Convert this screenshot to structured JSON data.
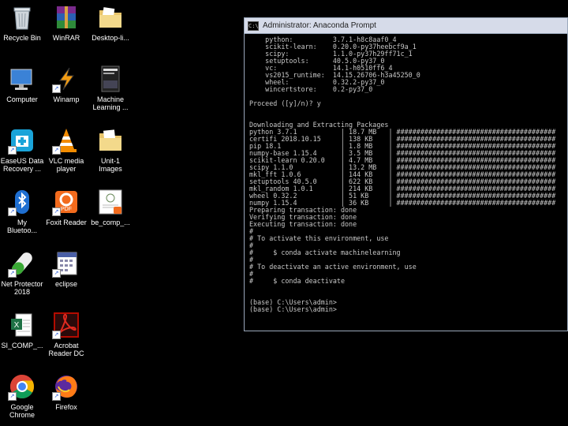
{
  "desktop": {
    "icons": [
      {
        "label": "Recycle Bin"
      },
      {
        "label": "WinRAR"
      },
      {
        "label": "Desktop-li..."
      },
      {
        "label": "Computer"
      },
      {
        "label": "Winamp"
      },
      {
        "label": "Machine\nLearning ..."
      },
      {
        "label": "EaseUS Data\nRecovery ..."
      },
      {
        "label": "VLC media\nplayer"
      },
      {
        "label": "Unit-1\nImages"
      },
      {
        "label": "My\nBluetoo..."
      },
      {
        "label": "Foxit Reader"
      },
      {
        "label": "be_comp_..."
      },
      {
        "label": "Net Protector\n2018"
      },
      {
        "label": "eclipse"
      },
      {
        "label": "SI_COMP_..."
      },
      {
        "label": "Acrobat\nReader DC"
      },
      {
        "label": "Google\nChrome"
      },
      {
        "label": "Firefox"
      }
    ]
  },
  "terminal": {
    "title": "Administrator: Anaconda Prompt",
    "lines": [
      "    python:          3.7.1-h8c8aaf0_4",
      "    scikit-learn:    0.20.0-py37heebcf9a_1",
      "    scipy:           1.1.0-py37h29ff71c_1",
      "    setuptools:      40.5.0-py37_0",
      "    vc:              14.1-h0510ff6_4",
      "    vs2015_runtime:  14.15.26706-h3a45250_0",
      "    wheel:           0.32.2-py37_0",
      "    wincertstore:    0.2-py37_0",
      "",
      "Proceed ([y]/n)? y",
      "",
      "",
      "Downloading and Extracting Packages",
      "python 3.7.1           | 18.7 MB   | ########################################",
      "certifi 2018.10.15     | 138 KB    | ########################################",
      "pip 18.1               | 1.8 MB    | ########################################",
      "numpy-base 1.15.4      | 3.5 MB    | ########################################",
      "scikit-learn 0.20.0    | 4.7 MB    | ########################################",
      "scipy 1.1.0            | 13.2 MB   | ########################################",
      "mkl_fft 1.0.6          | 144 KB    | ########################################",
      "setuptools 40.5.0      | 622 KB    | ########################################",
      "mkl_random 1.0.1       | 214 KB    | ########################################",
      "wheel 0.32.2           | 51 KB     | ########################################",
      "numpy 1.15.4           | 36 KB     | ########################################",
      "Preparing transaction: done",
      "Verifying transaction: done",
      "Executing transaction: done",
      "#",
      "# To activate this environment, use",
      "#",
      "#     $ conda activate machinelearning",
      "#",
      "# To deactivate an active environment, use",
      "#",
      "#     $ conda deactivate",
      "",
      "",
      "(base) C:\\Users\\admin>",
      "(base) C:\\Users\\admin>"
    ]
  }
}
